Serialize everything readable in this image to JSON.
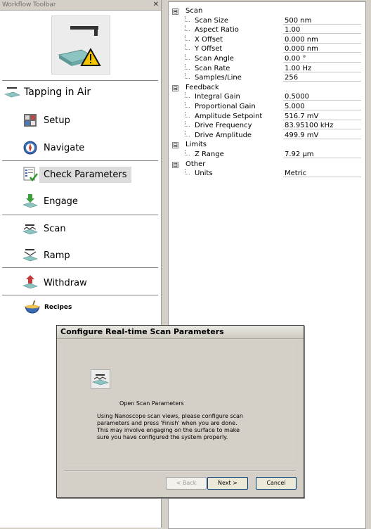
{
  "toolbar": {
    "title": "Workflow Toolbar",
    "close_glyph": "✕",
    "heading": "Tapping in Air",
    "items": [
      {
        "label": "Setup",
        "icon": "setup-icon"
      },
      {
        "label": "Navigate",
        "icon": "compass-icon"
      },
      {
        "label": "Check Parameters",
        "icon": "checklist-icon",
        "selected": true
      },
      {
        "label": "Engage",
        "icon": "engage-icon"
      },
      {
        "label": "Scan",
        "icon": "scan-icon"
      },
      {
        "label": "Ramp",
        "icon": "ramp-icon"
      },
      {
        "label": "Withdraw",
        "icon": "withdraw-icon"
      }
    ],
    "recipes_label": "Recipes"
  },
  "params": {
    "groups": [
      {
        "label": "Scan",
        "toggle": "⊟",
        "items": [
          {
            "name": "Scan Size",
            "value": "500 nm"
          },
          {
            "name": "Aspect Ratio",
            "value": "1.00"
          },
          {
            "name": "X Offset",
            "value": "0.000 nm"
          },
          {
            "name": "Y Offset",
            "value": "0.000 nm"
          },
          {
            "name": "Scan Angle",
            "value": "0.00 °"
          },
          {
            "name": "Scan Rate",
            "value": "1.00 Hz"
          },
          {
            "name": "Samples/Line",
            "value": "256"
          }
        ]
      },
      {
        "label": "Feedback",
        "toggle": "⊟",
        "items": [
          {
            "name": "Integral Gain",
            "value": "0.5000"
          },
          {
            "name": "Proportional Gain",
            "value": "5.000"
          },
          {
            "name": "Amplitude Setpoint",
            "value": "516.7 mV"
          },
          {
            "name": "Drive Frequency",
            "value": "83.95100 kHz"
          },
          {
            "name": "Drive Amplitude",
            "value": "499.9 mV"
          }
        ]
      },
      {
        "label": "Limits",
        "toggle": "⊟",
        "items": [
          {
            "name": "Z Range",
            "value": "7.92 µm"
          }
        ]
      },
      {
        "label": "Other",
        "toggle": "⊟",
        "items": [
          {
            "name": "Units",
            "value": "Metric"
          }
        ]
      }
    ]
  },
  "dialog": {
    "title": "Configure Real-time Scan Parameters",
    "step_title": "Open Scan Parameters",
    "step_desc": "Using Nanoscope scan views, please configure scan parameters and press 'Finish' when you are done.  This may involve engaging on the surface to make sure you have configured the system properly.",
    "back_label": "< Back",
    "next_label": "Next >",
    "cancel_label": "Cancel"
  },
  "colors": {
    "warning": "#f5c400",
    "accent": "#7fb8b4",
    "selection": "#dcdcdc"
  }
}
